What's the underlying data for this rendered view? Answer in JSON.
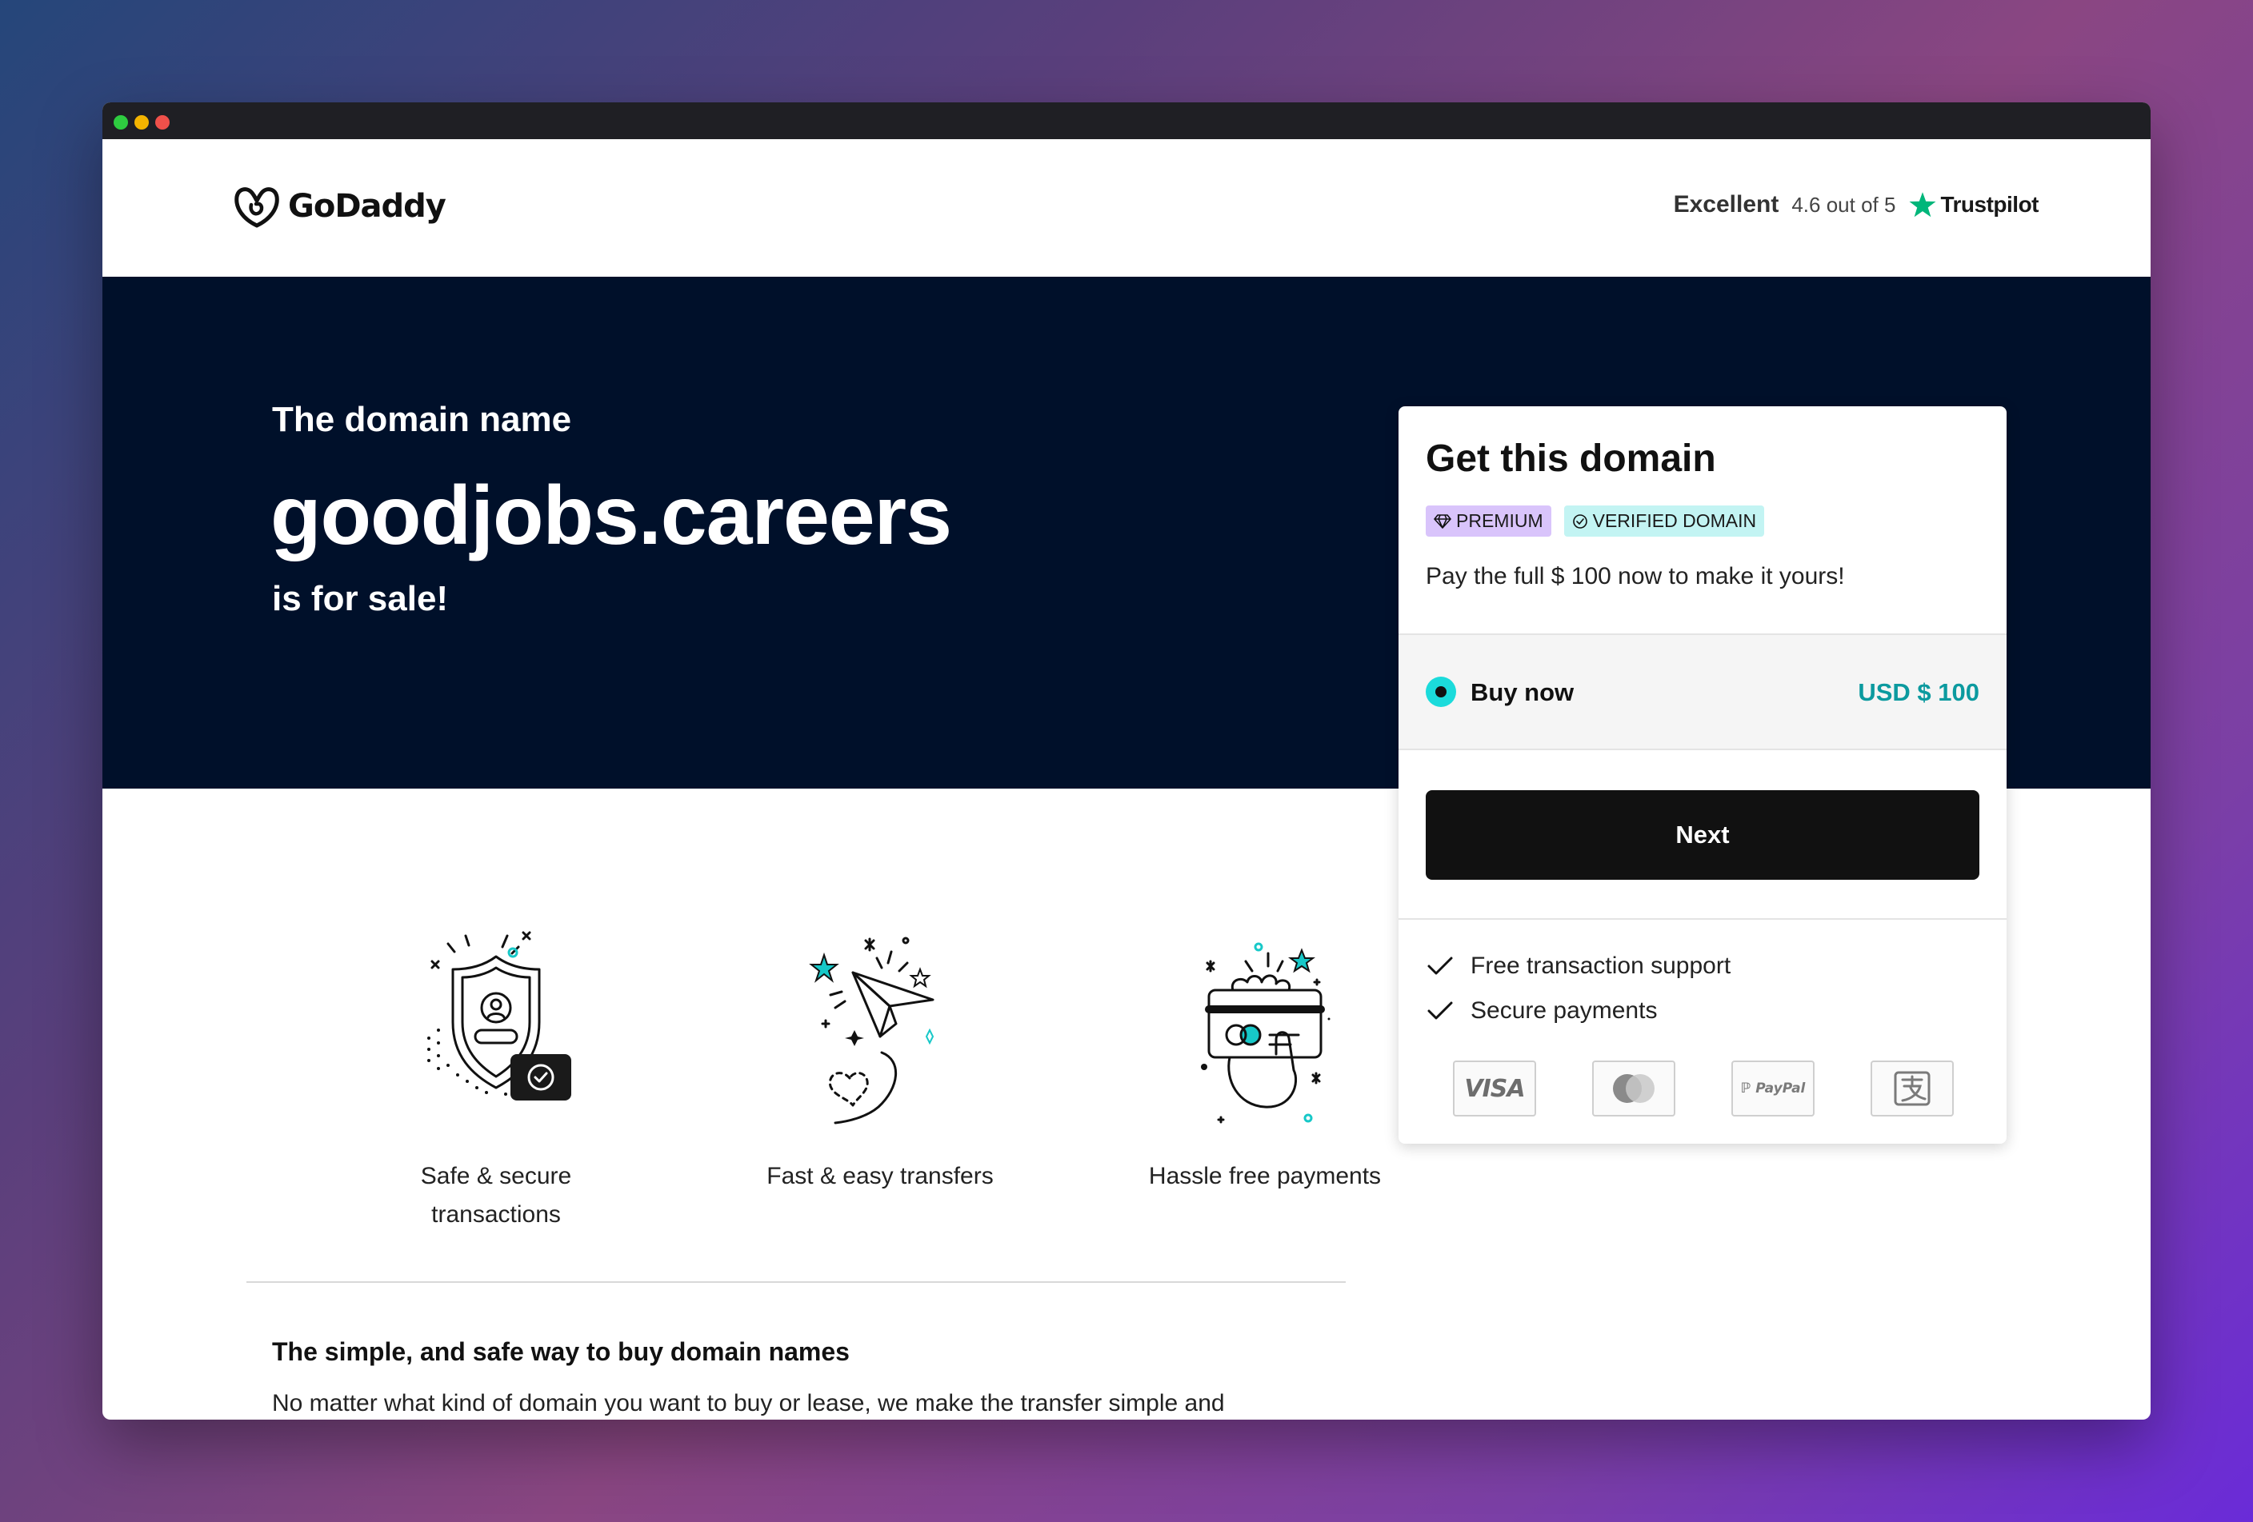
{
  "header": {
    "logo_text": "GoDaddy",
    "trust_label": "Excellent",
    "trust_score": "4.6 out of 5",
    "trust_brand": "Trustpilot"
  },
  "hero": {
    "pre": "The domain name",
    "domain": "goodjobs.careers",
    "post": "is for sale!"
  },
  "features": [
    {
      "label_line1": "Safe & secure",
      "label_line2": "transactions",
      "icon": "shield-check-icon"
    },
    {
      "label_line1": "Fast & easy transfers",
      "label_line2": "",
      "icon": "paper-plane-icon"
    },
    {
      "label_line1": "Hassle free payments",
      "label_line2": "",
      "icon": "credit-card-hand-icon"
    }
  ],
  "info": {
    "title": "The simple, and safe way to buy domain names",
    "body": "No matter what kind of domain you want to buy or lease, we make the transfer simple and"
  },
  "card": {
    "title": "Get this domain",
    "badge_premium": "PREMIUM",
    "badge_verified": "VERIFIED DOMAIN",
    "description": "Pay the full $ 100 now to make it yours!",
    "option_label": "Buy now",
    "option_price": "USD $ 100",
    "next_label": "Next",
    "checks": [
      "Free transaction support",
      "Secure payments"
    ],
    "payments": {
      "visa": "VISA",
      "paypal": "PayPal"
    }
  },
  "colors": {
    "hero_bg": "#00102a",
    "accent_teal": "#1bdbdb",
    "price_teal": "#0c9a9f",
    "premium_badge": "#d9c4fb",
    "verified_badge": "#c3f4f3",
    "trustpilot_green": "#00b67a"
  }
}
